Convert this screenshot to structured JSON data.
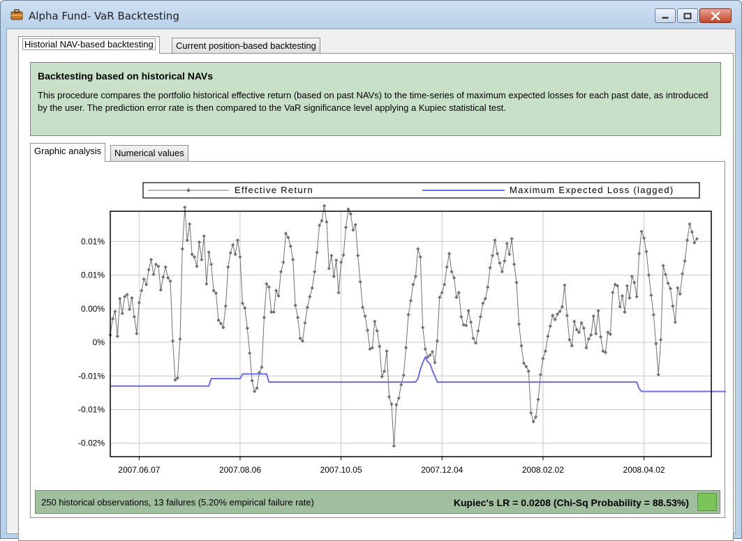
{
  "window": {
    "title": "Alpha Fund- VaR Backtesting"
  },
  "tabs": {
    "main": [
      {
        "label": "Historial NAV-based backtesting",
        "active": true
      },
      {
        "label": "Current position-based backtesting",
        "active": false
      }
    ],
    "sub": [
      {
        "label": "Graphic analysis",
        "active": true
      },
      {
        "label": "Numerical values",
        "active": false
      }
    ]
  },
  "info": {
    "title": "Backtesting based on historical NAVs",
    "description": "This procedure compares the portfolio historical effective return (based on past NAVs) to the time-series of maximum expected losses for each past date, as introduced by the user. The prediction error rate is then compared to the VaR significance level applying a Kupiec statistical test."
  },
  "status": {
    "summary": "250 historical observations, 13 failures (5.20% empirical failure rate)",
    "kupiec": "Kupiec's LR = 0.0208 (Chi-Sq Probability = 88.53%)",
    "indicator_color": "#7ac45a"
  },
  "chart_data": {
    "type": "line",
    "title": "",
    "xlabel": "",
    "ylabel": "",
    "legend_position": "top",
    "grid": true,
    "y_range": [
      -0.022,
      0.0145
    ],
    "y_tick_values": [
      0.01,
      0.005,
      0.0,
      -0.005,
      -0.01,
      -0.015,
      -0.02,
      -0.025
    ],
    "y_tick_labels": [
      "0.01%",
      "0.01%",
      "0.00%",
      "0%",
      "-0.01%",
      "-0.01%",
      "-0.02%",
      "-0.02%"
    ],
    "x_tick_labels": [
      "2007.06.07",
      "2007.08.06",
      "2007.10.05",
      "2007.12.04",
      "2008.02.02",
      "2008.04.02"
    ],
    "x_index_range": [
      0,
      250
    ],
    "x_tick_index": [
      12,
      54,
      96,
      138,
      180,
      222
    ],
    "series": [
      {
        "name": "Effective Return",
        "color": "#707070",
        "marker": "diamond",
        "values": [
          -0.0039,
          -0.0015,
          -0.0004,
          -0.0041,
          0.0015,
          -0.0007,
          0.0018,
          0.0021,
          -0.0001,
          0.0016,
          -0.0012,
          -0.0037,
          0.0009,
          0.0027,
          0.0044,
          0.0036,
          0.0058,
          0.0073,
          0.0051,
          0.0066,
          0.0063,
          0.0028,
          0.0047,
          0.0062,
          0.0046,
          0.0041,
          -0.0048,
          -0.0106,
          -0.0103,
          -0.0045,
          0.0089,
          0.0151,
          0.0102,
          0.0126,
          0.0081,
          0.0077,
          0.0063,
          0.0099,
          0.0073,
          0.0108,
          0.0037,
          0.0084,
          0.0066,
          0.0027,
          0.0023,
          -0.0017,
          -0.0022,
          -0.0028,
          0.0004,
          0.0062,
          0.0083,
          0.0095,
          0.0081,
          0.0102,
          0.0077,
          0.0008,
          0.0001,
          -0.0029,
          -0.0066,
          -0.0107,
          -0.0123,
          -0.0118,
          -0.0095,
          -0.0087,
          -0.0013,
          0.0037,
          0.0032,
          -0.0005,
          -0.0005,
          0.0027,
          0.0019,
          0.0055,
          0.0069,
          0.0112,
          0.0106,
          0.0093,
          0.0073,
          0.0005,
          -0.0013,
          -0.0044,
          -0.0048,
          -0.0021,
          0.0002,
          0.0018,
          0.0031,
          0.0055,
          0.0084,
          0.0124,
          0.0131,
          0.0153,
          0.0129,
          0.006,
          0.0079,
          0.0048,
          0.0072,
          0.0024,
          0.0069,
          0.008,
          0.0121,
          0.0148,
          0.0141,
          0.0117,
          0.0125,
          0.0079,
          0.004,
          0.0002,
          -0.0011,
          -0.0032,
          -0.006,
          -0.0058,
          -0.0019,
          -0.0033,
          -0.0056,
          -0.0101,
          -0.0093,
          -0.0063,
          -0.0131,
          -0.0142,
          -0.0204,
          -0.0143,
          -0.0133,
          -0.0113,
          -0.0099,
          -0.0058,
          -0.0009,
          0.0012,
          0.0036,
          0.0048,
          0.0089,
          0.0077,
          -0.0028,
          -0.006,
          -0.0072,
          -0.0069,
          -0.0064,
          -0.008,
          -0.0048,
          0.0017,
          0.0024,
          0.0036,
          0.0062,
          0.0082,
          0.0055,
          0.0046,
          0.0017,
          0.0024,
          -0.0012,
          -0.0024,
          -0.0025,
          -0.0003,
          -0.002,
          -0.0044,
          -0.0051,
          -0.0033,
          -0.0012,
          0.0008,
          0.0015,
          0.0032,
          0.0061,
          0.0079,
          0.0102,
          0.0082,
          0.0068,
          0.0055,
          0.0071,
          0.0097,
          0.0081,
          0.0104,
          0.0066,
          0.0039,
          -0.0023,
          -0.0055,
          -0.0081,
          -0.0086,
          -0.0093,
          -0.0155,
          -0.0168,
          -0.0161,
          -0.0135,
          -0.0098,
          -0.0074,
          -0.0063,
          -0.0041,
          -0.0026,
          -0.001,
          -0.0016,
          -0.0008,
          -0.0004,
          0.0003,
          0.0035,
          -0.001,
          -0.0046,
          -0.0055,
          -0.0019,
          -0.0031,
          -0.0035,
          -0.0021,
          -0.0029,
          -0.0058,
          -0.0045,
          -0.0039,
          -0.0011,
          -0.0037,
          -0.0003,
          -0.0042,
          -0.0063,
          -0.0065,
          -0.0035,
          -0.0038,
          0.0024,
          0.0036,
          0.0034,
          0.0003,
          0.0019,
          -0.0005,
          0.0034,
          0.0016,
          0.0048,
          0.0039,
          0.0018,
          0.0082,
          0.0115,
          0.0105,
          0.0085,
          0.005,
          0.002,
          -0.0009,
          -0.0052,
          -0.0098,
          -0.0046,
          0.0064,
          0.0051,
          0.0038,
          0.003,
          0.0004,
          -0.002,
          0.0031,
          0.0022,
          0.0052,
          0.0071,
          0.0102,
          0.0126,
          0.0114,
          0.0098,
          0.0104
        ]
      },
      {
        "name": "Maximum Expected Loss (lagged)",
        "color": "#6b6bf5",
        "marker": "none",
        "values": [
          -0.0115,
          -0.0115,
          -0.0115,
          -0.0115,
          -0.0115,
          -0.0115,
          -0.0115,
          -0.0115,
          -0.0115,
          -0.0115,
          -0.0115,
          -0.0115,
          -0.0115,
          -0.0115,
          -0.0115,
          -0.0115,
          -0.0115,
          -0.0115,
          -0.0115,
          -0.0115,
          -0.0115,
          -0.0115,
          -0.0115,
          -0.0115,
          -0.0115,
          -0.0115,
          -0.0115,
          -0.0115,
          -0.0115,
          -0.0115,
          -0.0115,
          -0.0115,
          -0.0115,
          -0.0115,
          -0.0115,
          -0.0115,
          -0.0115,
          -0.0115,
          -0.0115,
          -0.0115,
          -0.0115,
          -0.0115,
          -0.0104,
          -0.0104,
          -0.0104,
          -0.0104,
          -0.0104,
          -0.0104,
          -0.0104,
          -0.0104,
          -0.0104,
          -0.0104,
          -0.0104,
          -0.0104,
          -0.0104,
          -0.0097,
          -0.0097,
          -0.0097,
          -0.0097,
          -0.0097,
          -0.0097,
          -0.0097,
          -0.0097,
          -0.0097,
          -0.0097,
          -0.0097,
          -0.0109,
          -0.0109,
          -0.0109,
          -0.0109,
          -0.0109,
          -0.0109,
          -0.0109,
          -0.0109,
          -0.0109,
          -0.0109,
          -0.0109,
          -0.0109,
          -0.0109,
          -0.0109,
          -0.0109,
          -0.0109,
          -0.0109,
          -0.0109,
          -0.0109,
          -0.0109,
          -0.0109,
          -0.0109,
          -0.0109,
          -0.0109,
          -0.0109,
          -0.0109,
          -0.0109,
          -0.0109,
          -0.0109,
          -0.0109,
          -0.0109,
          -0.0109,
          -0.0109,
          -0.0109,
          -0.0109,
          -0.0109,
          -0.0109,
          -0.0109,
          -0.0109,
          -0.0109,
          -0.0109,
          -0.0109,
          -0.0109,
          -0.0109,
          -0.0109,
          -0.0109,
          -0.0109,
          -0.0109,
          -0.0109,
          -0.0109,
          -0.0109,
          -0.0109,
          -0.0109,
          -0.0109,
          -0.0109,
          -0.0109,
          -0.0109,
          -0.0109,
          -0.0109,
          -0.0109,
          -0.0109,
          -0.0109,
          -0.0104,
          -0.009,
          -0.008,
          -0.0072,
          -0.0079,
          -0.0082,
          -0.0092,
          -0.01,
          -0.0109,
          -0.0109,
          -0.0109,
          -0.0109,
          -0.0109,
          -0.0109,
          -0.0109,
          -0.0109,
          -0.0109,
          -0.0109,
          -0.0109,
          -0.0109,
          -0.0109,
          -0.0109,
          -0.0109,
          -0.0109,
          -0.0109,
          -0.0109,
          -0.0109,
          -0.0109,
          -0.0109,
          -0.0109,
          -0.0109,
          -0.0109,
          -0.0109,
          -0.0109,
          -0.0109,
          -0.0109,
          -0.0109,
          -0.0109,
          -0.0109,
          -0.0109,
          -0.0109,
          -0.0109,
          -0.0109,
          -0.0109,
          -0.0109,
          -0.0109,
          -0.0109,
          -0.0109,
          -0.0109,
          -0.0109,
          -0.0109,
          -0.0109,
          -0.0109,
          -0.0109,
          -0.0109,
          -0.0109,
          -0.0109,
          -0.0109,
          -0.0109,
          -0.0109,
          -0.0109,
          -0.0109,
          -0.0109,
          -0.0109,
          -0.0109,
          -0.0109,
          -0.0109,
          -0.0109,
          -0.0109,
          -0.0109,
          -0.0109,
          -0.0109,
          -0.0109,
          -0.0109,
          -0.0109,
          -0.0109,
          -0.0109,
          -0.0109,
          -0.0109,
          -0.0109,
          -0.0109,
          -0.0109,
          -0.0109,
          -0.0109,
          -0.0109,
          -0.0109,
          -0.0109,
          -0.0109,
          -0.0109,
          -0.0109,
          -0.0109,
          -0.0109,
          -0.0119,
          -0.0123,
          -0.0123,
          -0.0123,
          -0.0123,
          -0.0123,
          -0.0123,
          -0.0123,
          -0.0123,
          -0.0123,
          -0.0123,
          -0.0123,
          -0.0123,
          -0.0123,
          -0.0123,
          -0.0123,
          -0.0123,
          -0.0123,
          -0.0123,
          -0.0123,
          -0.0123,
          -0.0123,
          -0.0123,
          -0.0123,
          -0.0123,
          -0.0123,
          -0.0123,
          -0.0123,
          -0.0123,
          -0.0123,
          -0.0123,
          -0.0123,
          -0.0123,
          -0.0123,
          -0.0123,
          -0.0123,
          -0.0123,
          -0.0123,
          -0.0123,
          -0.0123,
          -0.0123,
          -0.0123,
          -0.0123,
          -0.0123,
          -0.0123,
          -0.0123,
          -0.0123,
          -0.0123,
          -0.0123,
          -0.0123,
          -0.0123,
          -0.0123,
          -0.0123
        ]
      }
    ]
  }
}
